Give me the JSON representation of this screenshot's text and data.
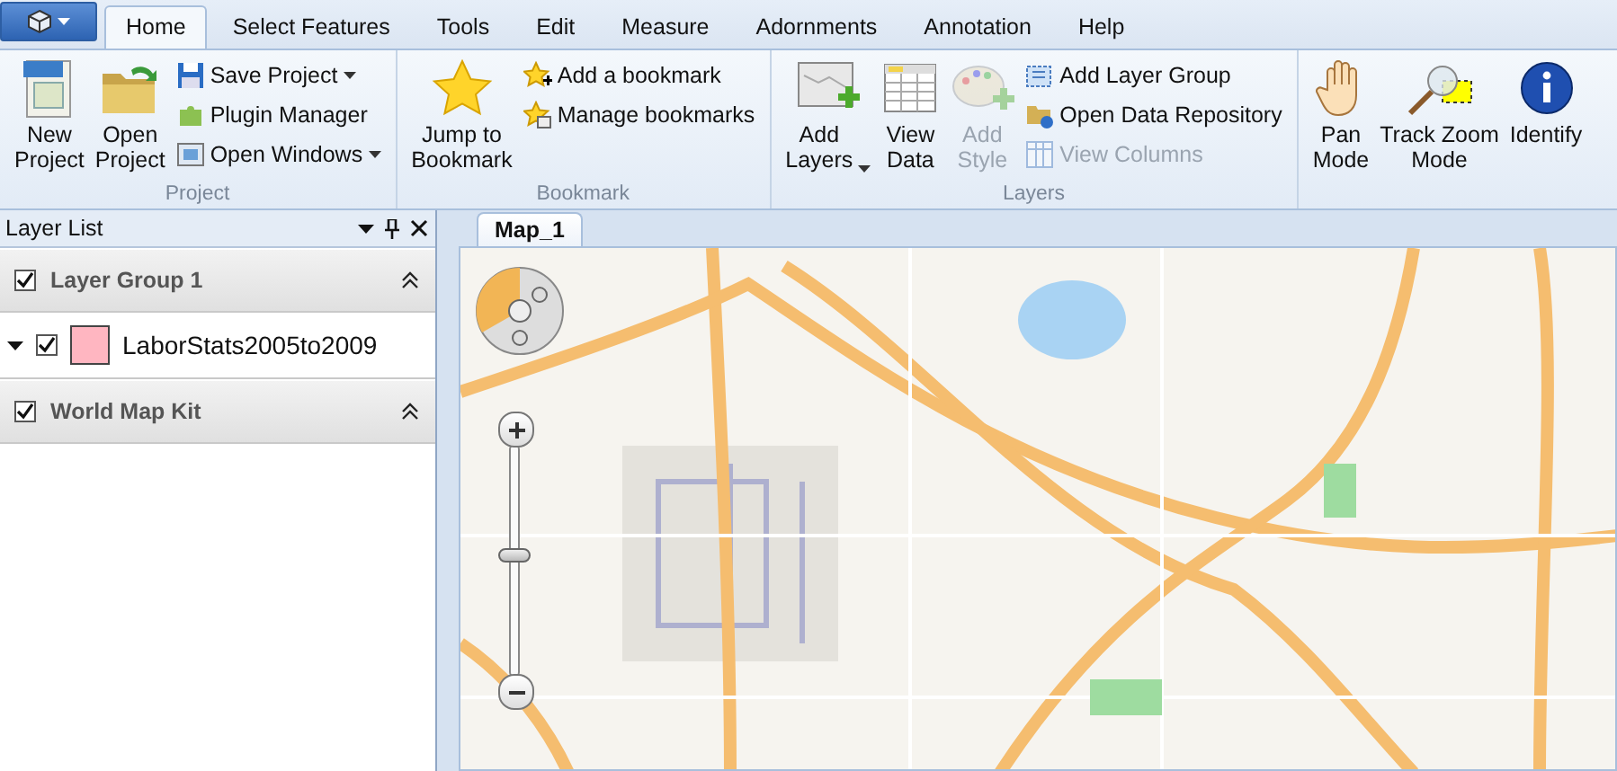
{
  "app_menu": {
    "has_menu": true
  },
  "tabs": [
    {
      "label": "Home",
      "selected": true
    },
    {
      "label": "Select Features",
      "selected": false
    },
    {
      "label": "Tools",
      "selected": false
    },
    {
      "label": "Edit",
      "selected": false
    },
    {
      "label": "Measure",
      "selected": false
    },
    {
      "label": "Adornments",
      "selected": false
    },
    {
      "label": "Annotation",
      "selected": false
    },
    {
      "label": "Help",
      "selected": false
    }
  ],
  "ribbon_groups": [
    {
      "label": "Project",
      "large_buttons": [
        {
          "label": "New\nProject",
          "disabled": false,
          "has_menu": false
        },
        {
          "label": "Open\nProject",
          "disabled": false,
          "has_menu": false
        }
      ],
      "small_buttons": [
        {
          "label": "Save Project",
          "disabled": false,
          "has_menu": true
        },
        {
          "label": "Plugin Manager",
          "disabled": false,
          "has_menu": false
        },
        {
          "label": "Open Windows",
          "disabled": false,
          "has_menu": true
        }
      ]
    },
    {
      "label": "Bookmark",
      "large_buttons": [
        {
          "label": "Jump to\nBookmark",
          "disabled": false,
          "has_menu": false
        }
      ],
      "small_buttons": [
        {
          "label": "Add a bookmark",
          "disabled": false,
          "has_menu": false
        },
        {
          "label": "Manage bookmarks",
          "disabled": false,
          "has_menu": false
        }
      ]
    },
    {
      "label": "Layers",
      "large_buttons": [
        {
          "label": "Add\nLayers",
          "disabled": false,
          "has_menu": true
        },
        {
          "label": "View\nData",
          "disabled": false,
          "has_menu": false
        },
        {
          "label": "Add\nStyle",
          "disabled": true,
          "has_menu": false
        }
      ],
      "small_buttons": [
        {
          "label": "Add Layer Group",
          "disabled": false,
          "has_menu": false
        },
        {
          "label": "Open Data Repository",
          "disabled": false,
          "has_menu": false
        },
        {
          "label": "View Columns",
          "disabled": true,
          "has_menu": false
        }
      ]
    },
    {
      "large_buttons": [
        {
          "label": "Pan\nMode",
          "disabled": false,
          "has_menu": false
        },
        {
          "label": "Track Zoom\nMode",
          "disabled": false,
          "has_menu": false
        },
        {
          "label": "Identify",
          "disabled": false,
          "has_menu": false
        }
      ]
    }
  ],
  "layer_panel": {
    "title": "Layer List",
    "groups": [
      {
        "name": "Layer Group 1",
        "checked": true,
        "expanded": true,
        "children": [
          {
            "name": "LaborStats2005to2009",
            "checked": true,
            "expanded": true,
            "color": "#ffb6c1"
          }
        ]
      },
      {
        "name": "World Map Kit",
        "checked": true,
        "expanded": true
      }
    ]
  },
  "document_tabs": [
    {
      "label": "Map_1",
      "selected": true
    }
  ],
  "map": {
    "zoom_slider": {
      "level": 0.52
    }
  }
}
